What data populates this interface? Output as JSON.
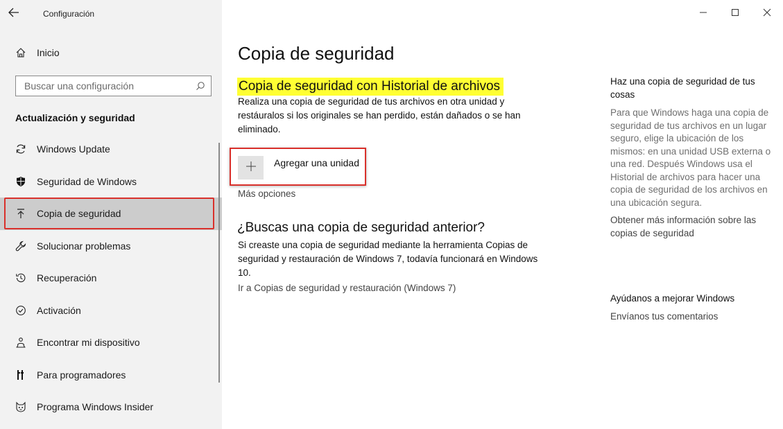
{
  "window": {
    "app_title": "Configuración",
    "back_icon": "back-arrow-icon",
    "controls": [
      "minimize-icon",
      "maximize-icon",
      "close-icon"
    ]
  },
  "sidebar": {
    "home_label": "Inicio",
    "search_placeholder": "Buscar una configuración",
    "section_title": "Actualización y seguridad",
    "items": [
      {
        "label": "Windows Update",
        "icon": "refresh-icon"
      },
      {
        "label": "Seguridad de Windows",
        "icon": "shield-icon"
      },
      {
        "label": "Copia de seguridad",
        "icon": "upload-arrow-icon",
        "selected": true
      },
      {
        "label": "Solucionar problemas",
        "icon": "wrench-icon"
      },
      {
        "label": "Recuperación",
        "icon": "history-icon"
      },
      {
        "label": "Activación",
        "icon": "check-circle-icon"
      },
      {
        "label": "Encontrar mi dispositivo",
        "icon": "person-locate-icon"
      },
      {
        "label": "Para programadores",
        "icon": "developer-tools-icon"
      },
      {
        "label": "Programa Windows Insider",
        "icon": "insider-cat-icon"
      }
    ]
  },
  "main": {
    "page_title": "Copia de seguridad",
    "file_history_title": "Copia de seguridad con Historial de archivos",
    "file_history_desc": "Realiza una copia de seguridad de tus archivos en otra unidad y restáuralos si los originales se han perdido, están dañados o se han eliminado.",
    "add_drive_label": "Agregar una unidad",
    "more_options": "Más opciones",
    "older_backup_title": "¿Buscas una copia de seguridad anterior?",
    "older_backup_desc": "Si creaste una copia de seguridad mediante la herramienta Copias de seguridad y restauración de Windows 7, todavía funcionará en Windows 10.",
    "older_backup_link": "Ir a Copias de seguridad y restauración (Windows 7)"
  },
  "right_panel": {
    "title": "Haz una copia de seguridad de tus cosas",
    "body": "Para que Windows haga una copia de seguridad de tus archivos en un lugar seguro, elige la ubicación de los mismos: en una unidad USB externa o una red. Después Windows usa el Historial de archivos para hacer una copia de seguridad de los archivos en una ubicación segura.",
    "link": "Obtener más información sobre las copias de seguridad",
    "feedback_title": "Ayúdanos a mejorar Windows",
    "feedback_link": "Envíanos tus comentarios"
  },
  "colors": {
    "highlight": "#ffff33",
    "annotation_red": "#d9302b",
    "sidebar_bg": "#f2f2f2",
    "selected_bg": "#cccccc"
  }
}
